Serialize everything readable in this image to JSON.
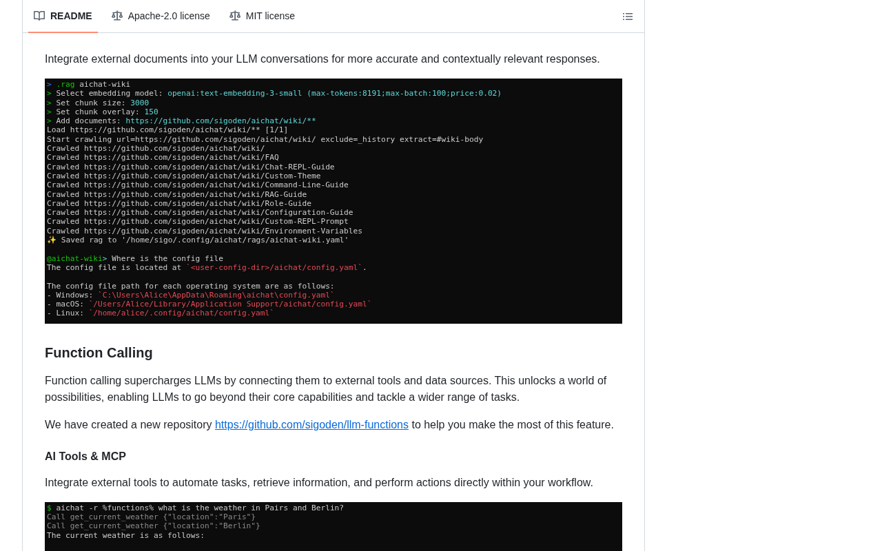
{
  "tabs": [
    {
      "label": "README",
      "selected": true
    },
    {
      "label": "Apache-2.0 license",
      "selected": false
    },
    {
      "label": "MIT license",
      "selected": false
    }
  ],
  "sections": [
    {
      "kind": "p",
      "text": "Integrate external documents into your LLM conversations for more accurate and contextually relevant responses."
    },
    {
      "kind": "terminal",
      "lines": [
        {
          "kind": "text",
          "segments": [
            {
              "kind": "marker",
              "text": ">"
            },
            {
              "kind": "prompt",
              "text": " .rag"
            },
            {
              "kind": "plain",
              "text": " aichat-wiki"
            }
          ]
        },
        {
          "kind": "text",
          "segments": [
            {
              "kind": "prompt",
              "text": ">"
            },
            {
              "kind": "plain",
              "text": " Select embedding model: "
            },
            {
              "kind": "value",
              "text": "openai:text-embedding-3-small (max-tokens:8191;max-batch:100;price:0.02)"
            }
          ]
        },
        {
          "kind": "text",
          "segments": [
            {
              "kind": "prompt",
              "text": ">"
            },
            {
              "kind": "plain",
              "text": " Set chunk size: "
            },
            {
              "kind": "value",
              "text": "3000"
            }
          ]
        },
        {
          "kind": "text",
          "segments": [
            {
              "kind": "prompt",
              "text": ">"
            },
            {
              "kind": "plain",
              "text": " Set chunk overlay: "
            },
            {
              "kind": "value",
              "text": "150"
            }
          ]
        },
        {
          "kind": "text",
          "segments": [
            {
              "kind": "prompt",
              "text": ">"
            },
            {
              "kind": "plain",
              "text": " Add documents: "
            },
            {
              "kind": "value",
              "text": "https://github.com/sigoden/aichat/wiki/**"
            }
          ]
        },
        {
          "kind": "text",
          "segments": [
            {
              "kind": "plain",
              "text": "Load https://github.com/sigoden/aichat/wiki/** [1/1]"
            }
          ]
        },
        {
          "kind": "text",
          "segments": [
            {
              "kind": "plain",
              "text": "Start crawling url=https://github.com/sigoden/aichat/wiki/ exclude=_history extract=#wiki-body"
            }
          ]
        },
        {
          "kind": "text",
          "segments": [
            {
              "kind": "plain",
              "text": "Crawled https://github.com/sigoden/aichat/wiki/"
            }
          ]
        },
        {
          "kind": "text",
          "segments": [
            {
              "kind": "plain",
              "text": "Crawled https://github.com/sigoden/aichat/wiki/FAQ"
            }
          ]
        },
        {
          "kind": "text",
          "segments": [
            {
              "kind": "plain",
              "text": "Crawled https://github.com/sigoden/aichat/wiki/Chat-REPL-Guide"
            }
          ]
        },
        {
          "kind": "text",
          "segments": [
            {
              "kind": "plain",
              "text": "Crawled https://github.com/sigoden/aichat/wiki/Custom-Theme"
            }
          ]
        },
        {
          "kind": "text",
          "segments": [
            {
              "kind": "plain",
              "text": "Crawled https://github.com/sigoden/aichat/wiki/Command-Line-Guide"
            }
          ]
        },
        {
          "kind": "text",
          "segments": [
            {
              "kind": "plain",
              "text": "Crawled https://github.com/sigoden/aichat/wiki/RAG-Guide"
            }
          ]
        },
        {
          "kind": "text",
          "segments": [
            {
              "kind": "plain",
              "text": "Crawled https://github.com/sigoden/aichat/wiki/Role-Guide"
            }
          ]
        },
        {
          "kind": "text",
          "segments": [
            {
              "kind": "plain",
              "text": "Crawled https://github.com/sigoden/aichat/wiki/Configuration-Guide"
            }
          ]
        },
        {
          "kind": "text",
          "segments": [
            {
              "kind": "plain",
              "text": "Crawled https://github.com/sigoden/aichat/wiki/Custom-REPL-Prompt"
            }
          ]
        },
        {
          "kind": "text",
          "segments": [
            {
              "kind": "plain",
              "text": "Crawled https://github.com/sigoden/aichat/wiki/Environment-Variables"
            }
          ]
        },
        {
          "kind": "text",
          "segments": [
            {
              "kind": "plain",
              "text": "✨ Saved rag to '/home/sigo/.config/aichat/rags/aichat-wiki.yaml'"
            }
          ]
        },
        {
          "kind": "blank"
        },
        {
          "kind": "text",
          "segments": [
            {
              "kind": "prompt",
              "text": "@aichat-wiki"
            },
            {
              "kind": "value",
              "text": ">"
            },
            {
              "kind": "plain",
              "text": " Where is the config file"
            }
          ]
        },
        {
          "kind": "text",
          "segments": [
            {
              "kind": "plain",
              "text": "The config file is located at "
            },
            {
              "kind": "path",
              "text": "`<user-config-dir>/aichat/config.yaml`"
            },
            {
              "kind": "plain",
              "text": "."
            }
          ]
        },
        {
          "kind": "blank"
        },
        {
          "kind": "text",
          "segments": [
            {
              "kind": "plain",
              "text": "The config file path for each operating system are as follows:"
            }
          ]
        },
        {
          "kind": "text",
          "segments": [
            {
              "kind": "plain",
              "text": "- Windows: "
            },
            {
              "kind": "path",
              "text": "`C:\\Users\\Alice\\AppData\\Roaming\\aichat\\config.yaml`"
            }
          ]
        },
        {
          "kind": "text",
          "segments": [
            {
              "kind": "plain",
              "text": "- macOS: "
            },
            {
              "kind": "path",
              "text": "`/Users/Alice/Library/Application Support/aichat/config.yaml`"
            }
          ]
        },
        {
          "kind": "text",
          "segments": [
            {
              "kind": "plain",
              "text": "- Linux: "
            },
            {
              "kind": "path",
              "text": "`/home/alice/.config/aichat/config.yaml`"
            }
          ]
        }
      ]
    },
    {
      "kind": "h3",
      "text": "Function Calling"
    },
    {
      "kind": "p",
      "text": "Function calling supercharges LLMs by connecting them to external tools and data sources. This unlocks a world of possibilities, enabling LLMs to go beyond their core capabilities and tackle a wider range of tasks."
    },
    {
      "kind": "linkp",
      "before": "We have created a new repository ",
      "link": "https://github.com/sigoden/llm-functions",
      "after": " to help you make the most of this feature."
    },
    {
      "kind": "h4",
      "text": "AI Tools & MCP"
    },
    {
      "kind": "p",
      "text": "Integrate external tools to automate tasks, retrieve information, and perform actions directly within your workflow."
    },
    {
      "kind": "terminal",
      "lines": [
        {
          "kind": "text",
          "segments": [
            {
              "kind": "prompt",
              "text": "$"
            },
            {
              "kind": "plain",
              "text": " aichat -r %functions% what is the weather in Pairs and Berlin?"
            }
          ]
        },
        {
          "kind": "text",
          "segments": [
            {
              "kind": "muted",
              "text": "Call get_current_weather {\"location\":\"Paris\"}"
            }
          ]
        },
        {
          "kind": "text",
          "segments": [
            {
              "kind": "muted",
              "text": "Call get_current_weather {\"location\":\"Berlin\"}"
            }
          ]
        },
        {
          "kind": "text",
          "segments": [
            {
              "kind": "plain",
              "text": "The current weather is as follows:"
            }
          ]
        }
      ]
    }
  ]
}
